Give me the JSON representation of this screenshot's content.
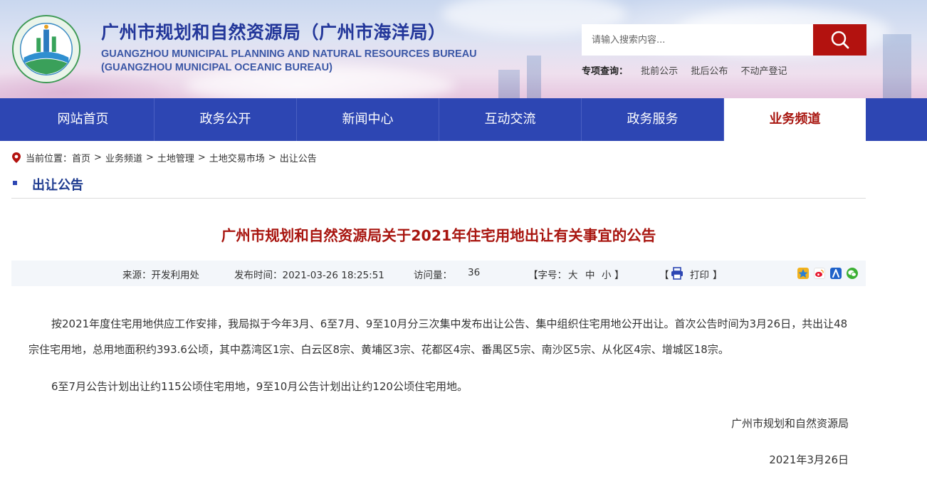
{
  "header": {
    "title_cn": "广州市规划和自然资源局（广州市海洋局）",
    "title_en_1": "GUANGZHOU MUNICIPAL PLANNING AND NATURAL RESOURCES BUREAU",
    "title_en_2": "(GUANGZHOU MUNICIPAL OCEANIC BUREAU)",
    "search_placeholder": "请输入搜索内容...",
    "quick_label": "专项查询：",
    "quick_links": [
      "批前公示",
      "批后公布",
      "不动产登记"
    ]
  },
  "nav": {
    "items": [
      "网站首页",
      "政务公开",
      "新闻中心",
      "互动交流",
      "政务服务",
      "业务频道"
    ],
    "active_index": 5
  },
  "breadcrumb": {
    "label": "当前位置：",
    "items": [
      "首页",
      "业务频道",
      "土地管理",
      "土地交易市场",
      "出让公告"
    ],
    "separator": ">"
  },
  "section": {
    "title": "出让公告"
  },
  "article": {
    "title": "广州市规划和自然资源局关于2021年住宅用地出让有关事宜的公告",
    "meta": {
      "source": "来源：开发利用处",
      "publish_time": "发布时间：2021-03-26 18:25:51",
      "visits_label": "访问量：",
      "visits": "36",
      "font_label": "【字号：",
      "font_sizes": [
        "大",
        "中",
        "小"
      ],
      "font_close": "】",
      "print_open": "【",
      "print_label": "打印",
      "print_close": "】"
    },
    "paragraphs": [
      "按2021年度住宅用地供应工作安排，我局拟于今年3月、6至7月、9至10月分三次集中发布出让公告、集中组织住宅用地公开出让。首次公告时间为3月26日，共出让48宗住宅用地，总用地面积约393.6公顷，其中荔湾区1宗、白云区8宗、黄埔区3宗、花都区4宗、番禺区5宗、南沙区5宗、从化区4宗、增城区18宗。",
      "6至7月公告计划出让约115公顷住宅用地，9至10月公告计划出让约120公顷住宅用地。"
    ],
    "signature": "广州市规划和自然资源局",
    "date": "2021年3月26日"
  },
  "colors": {
    "nav_bg": "#2d46b3",
    "accent_red": "#a8150f",
    "search_btn": "#b3120f",
    "title_blue": "#23379a"
  },
  "share_icons": [
    "qzone-icon",
    "weibo-icon",
    "renren-icon",
    "wechat-icon"
  ]
}
